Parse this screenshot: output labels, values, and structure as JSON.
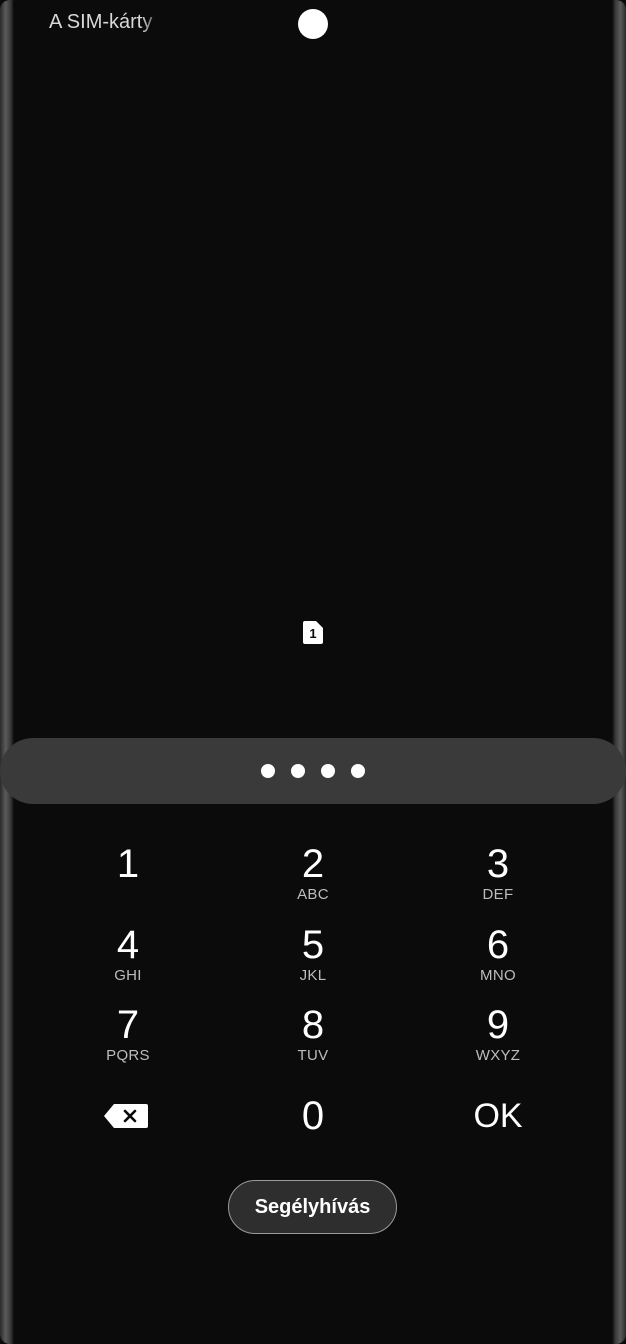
{
  "status_bar": {
    "carrier_text": "A SIM-kárty"
  },
  "sim_icon": {
    "label": "1",
    "name": "sim-card-icon"
  },
  "pin_entry": {
    "dot_count": 4
  },
  "keypad": {
    "keys": [
      {
        "digit": "1",
        "letters": ""
      },
      {
        "digit": "2",
        "letters": "ABC"
      },
      {
        "digit": "3",
        "letters": "DEF"
      },
      {
        "digit": "4",
        "letters": "GHI"
      },
      {
        "digit": "5",
        "letters": "JKL"
      },
      {
        "digit": "6",
        "letters": "MNO"
      },
      {
        "digit": "7",
        "letters": "PQRS"
      },
      {
        "digit": "8",
        "letters": "TUV"
      },
      {
        "digit": "9",
        "letters": "WXYZ"
      },
      {
        "digit": "0",
        "letters": ""
      }
    ],
    "ok_label": "OK",
    "backspace_icon": "backspace-icon"
  },
  "emergency_call": {
    "label": "Segélyhívás"
  }
}
